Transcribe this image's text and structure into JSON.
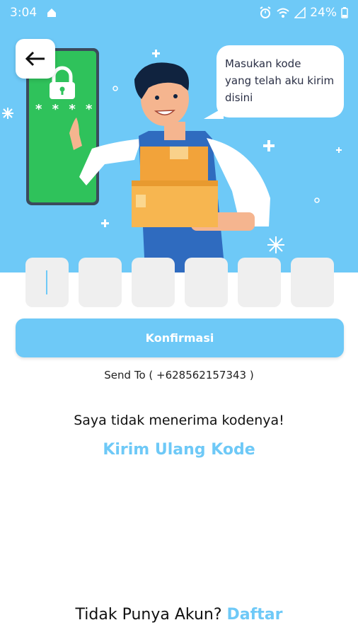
{
  "status_bar": {
    "time": "3:04",
    "battery": "24%"
  },
  "hero": {
    "speech_bubble": "Masukan kode\nyang telah aku kirim\ndisini",
    "phone_pin_mask": "* * * *"
  },
  "otp": {
    "boxes": [
      "",
      "",
      "",
      "",
      "",
      ""
    ]
  },
  "confirm_button": "Konfirmasi",
  "send_to": "Send To ( +628562157343 )",
  "not_received": "Saya tidak menerima kodenya!",
  "resend_link": "Kirim Ulang Kode",
  "footer": {
    "question": "Tidak Punya Akun?",
    "signup_link": "Daftar"
  },
  "colors": {
    "accent": "#6ec9f7",
    "phone_screen": "#2fc25b"
  },
  "icons": [
    "back-arrow-icon",
    "lock-icon",
    "alarm-icon",
    "wifi-icon",
    "signal-icon",
    "battery-icon",
    "home-icon"
  ]
}
